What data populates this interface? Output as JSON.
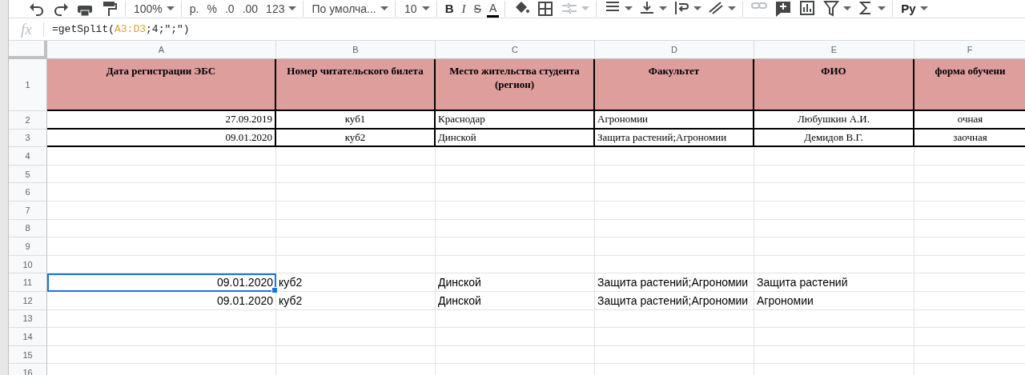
{
  "toolbar": {
    "groups": [
      [
        {
          "kind": "undo",
          "disabled": false
        },
        {
          "kind": "redo",
          "disabled": false
        },
        {
          "kind": "print",
          "disabled": false
        },
        {
          "kind": "paint",
          "disabled": false
        }
      ],
      [
        {
          "kind": "dropdown",
          "label": "100%",
          "disabled": false
        }
      ],
      [
        {
          "kind": "text",
          "label": "р.",
          "disabled": false
        },
        {
          "kind": "text",
          "label": "%",
          "disabled": false
        },
        {
          "kind": "decimal-less",
          "label": ".0",
          "disabled": false
        },
        {
          "kind": "decimal-more",
          "label": ".00",
          "disabled": false
        },
        {
          "kind": "dropdown",
          "label": "123",
          "disabled": false
        }
      ],
      [
        {
          "kind": "dropdown",
          "label": "По умолча...",
          "disabled": false
        }
      ],
      [
        {
          "kind": "dropdown",
          "label": "10",
          "disabled": false
        }
      ],
      [
        {
          "kind": "bold",
          "label": "B",
          "disabled": false
        },
        {
          "kind": "italic",
          "label": "I",
          "disabled": false
        },
        {
          "kind": "strike",
          "label": "S",
          "disabled": false
        },
        {
          "kind": "textcolor",
          "label": "A",
          "disabled": false
        }
      ],
      [
        {
          "kind": "fill",
          "disabled": false
        },
        {
          "kind": "borders",
          "disabled": false
        },
        {
          "kind": "merge",
          "disabled": true
        }
      ],
      [
        {
          "kind": "halign",
          "disabled": false
        },
        {
          "kind": "valign",
          "disabled": false
        },
        {
          "kind": "wrap",
          "disabled": false
        },
        {
          "kind": "rotate",
          "disabled": false
        }
      ],
      [
        {
          "kind": "link",
          "disabled": true
        },
        {
          "kind": "comment",
          "disabled": false
        },
        {
          "kind": "chart",
          "disabled": false
        },
        {
          "kind": "filter",
          "disabled": false
        },
        {
          "kind": "sum",
          "disabled": false
        }
      ],
      [
        {
          "kind": "input",
          "label": "Ру",
          "disabled": false
        }
      ]
    ]
  },
  "formula_bar": {
    "label": "fx",
    "parts": [
      {
        "text": "=getSplit(",
        "color": "#202124"
      },
      {
        "text": "A3:D3",
        "color": "#e0a030"
      },
      {
        "text": ";4;",
        "color": "#202124"
      },
      {
        "text": "\";\"",
        "color": "#202124"
      },
      {
        "text": ")",
        "color": "#202124"
      }
    ]
  },
  "sheet": {
    "columns": [
      "A",
      "B",
      "C",
      "D",
      "E",
      "F"
    ],
    "rows": [
      {
        "number": "1",
        "kind": "header",
        "cells": [
          {
            "text": "Дата регистрации ЭБС",
            "selected": false
          },
          {
            "text": "Номер читательского билета",
            "selected": false
          },
          {
            "text": "Место жительства студента (регион)",
            "selected": false
          },
          {
            "text": "Факультет",
            "selected": false
          },
          {
            "text": "ФИО",
            "selected": false
          },
          {
            "text": "форма обучени",
            "selected": false
          }
        ]
      },
      {
        "number": "2",
        "kind": "bordered",
        "cells": [
          {
            "text": "27.09.2019",
            "selected": false
          },
          {
            "text": "куб1",
            "selected": false
          },
          {
            "text": "Краснодар",
            "selected": false
          },
          {
            "text": "Агрономии",
            "selected": false
          },
          {
            "text": "Любушкин А.И.",
            "selected": false
          },
          {
            "text": "очная",
            "selected": false
          }
        ]
      },
      {
        "number": "3",
        "kind": "bordered",
        "cells": [
          {
            "text": "09.01.2020",
            "selected": false
          },
          {
            "text": "куб2",
            "selected": false
          },
          {
            "text": "Динской",
            "selected": false
          },
          {
            "text": "Защита растений;Агрономии",
            "selected": false
          },
          {
            "text": "Демидов В.Г.",
            "selected": false
          },
          {
            "text": "заочная",
            "selected": false
          }
        ]
      },
      {
        "number": "4",
        "kind": "plain"
      },
      {
        "number": "5",
        "kind": "plain"
      },
      {
        "number": "6",
        "kind": "plain"
      },
      {
        "number": "7",
        "kind": "plain"
      },
      {
        "number": "8",
        "kind": "plain"
      },
      {
        "number": "9",
        "kind": "plain"
      },
      {
        "number": "10",
        "kind": "plain"
      },
      {
        "number": "11",
        "kind": "plain",
        "cells": [
          {
            "text": "09.01.2020",
            "selected": true
          },
          {
            "text": "куб2",
            "selected": false
          },
          {
            "text": "Динской",
            "selected": false
          },
          {
            "text": "Защита растений;Агрономии",
            "selected": false
          },
          {
            "text": "Защита растений",
            "selected": false
          }
        ]
      },
      {
        "number": "12",
        "kind": "plain",
        "cells": [
          {
            "text": "09.01.2020",
            "selected": false
          },
          {
            "text": "куб2",
            "selected": false
          },
          {
            "text": "Динской",
            "selected": false
          },
          {
            "text": "Защита растений;Агрономии",
            "selected": false
          },
          {
            "text": "Агрономии",
            "selected": false
          }
        ]
      },
      {
        "number": "13",
        "kind": "plain"
      },
      {
        "number": "14",
        "kind": "plain"
      },
      {
        "number": "15",
        "kind": "plain"
      },
      {
        "number": "16",
        "kind": "plain"
      }
    ]
  }
}
